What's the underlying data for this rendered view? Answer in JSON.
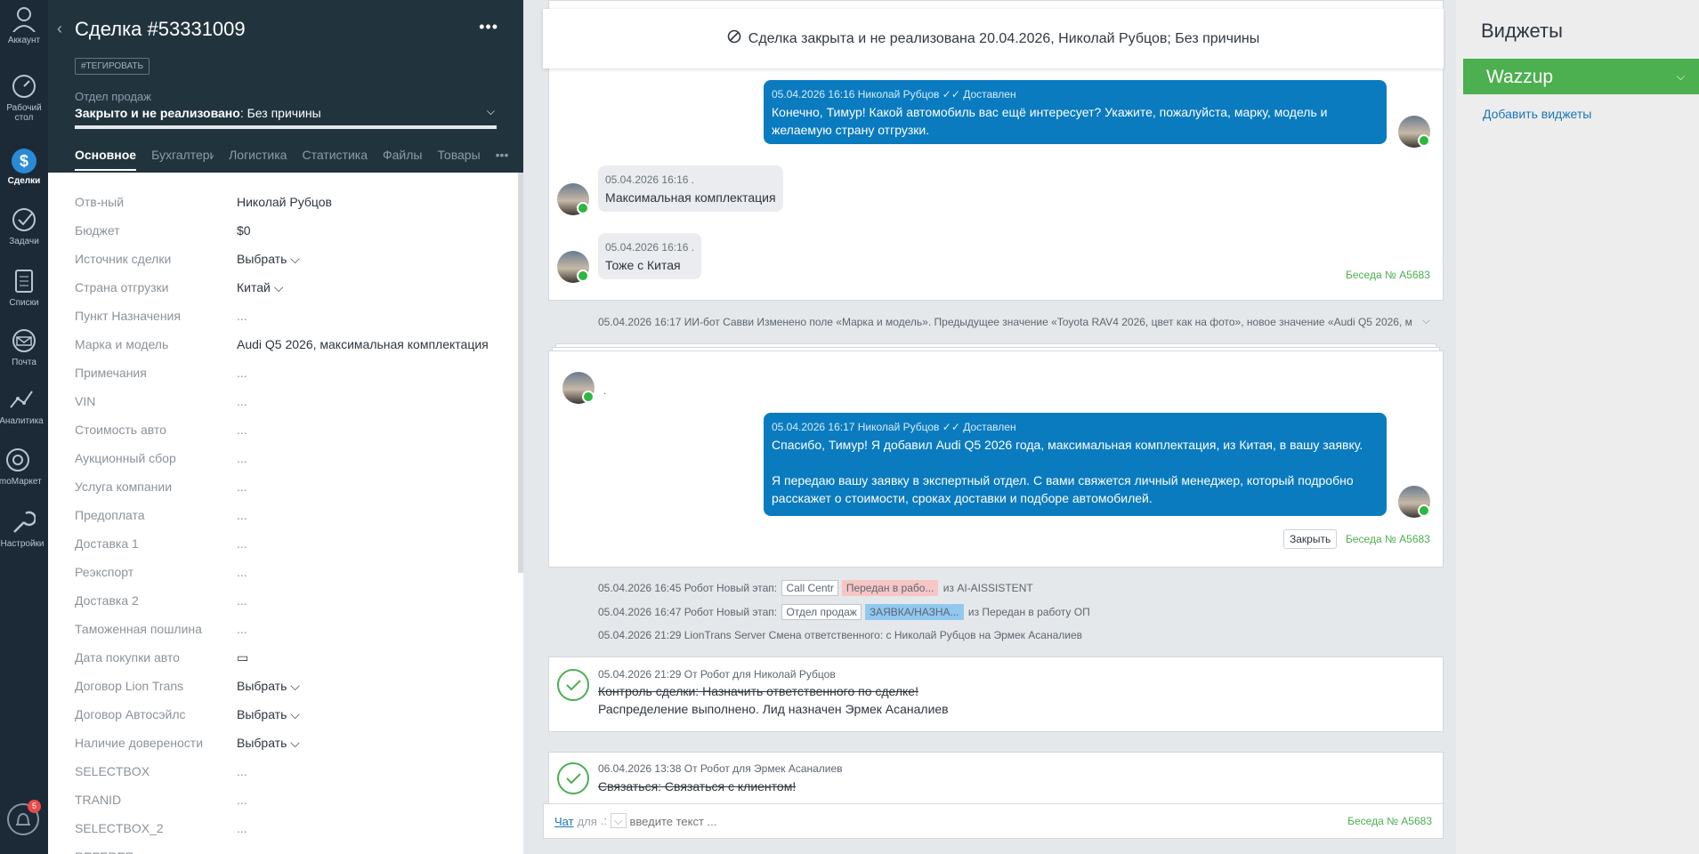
{
  "nav": {
    "items": [
      {
        "label": "Аккаунт"
      },
      {
        "label": "Рабочий стол"
      },
      {
        "label": "Сделки"
      },
      {
        "label": "Задачи"
      },
      {
        "label": "Списки"
      },
      {
        "label": "Почта"
      },
      {
        "label": "Аналитика"
      },
      {
        "label": "amoМаркет"
      },
      {
        "label": "Настройки"
      }
    ],
    "notifications": "5"
  },
  "lead": {
    "title": "Сделка #53331009",
    "tag_button": "#ТЕГИРОВАТЬ",
    "pipeline_label": "Отдел продаж",
    "status_bold": "Закрыто и не реализовано",
    "status_rest": ": Без причины",
    "tabs": [
      "Основное",
      "Бухгалтерия",
      "Логистика",
      "Статистика",
      "Файлы",
      "Товары"
    ]
  },
  "fields": [
    {
      "k": "Отв-ный",
      "v": "Николай Рубцов"
    },
    {
      "k": "Бюджет",
      "v": "$0"
    },
    {
      "k": "Источник сделки",
      "v": "Выбрать ⌵"
    },
    {
      "k": "Страна отгрузки",
      "v": "Китай ⌵"
    },
    {
      "k": "Пункт Назначения",
      "v": "..."
    },
    {
      "k": "Марка и модель",
      "v": "Audi Q5 2026, максимальная комплектация"
    },
    {
      "k": "Примечания",
      "v": "..."
    },
    {
      "k": "VIN",
      "v": "..."
    },
    {
      "k": "Стоимость авто",
      "v": "..."
    },
    {
      "k": "Аукционный сбор",
      "v": "..."
    },
    {
      "k": "Услуга компании",
      "v": "..."
    },
    {
      "k": "Предоплата",
      "v": "..."
    },
    {
      "k": "Доставка 1",
      "v": "..."
    },
    {
      "k": "Реэкспорт",
      "v": "..."
    },
    {
      "k": "Доставка 2",
      "v": "..."
    },
    {
      "k": "Таможенная пошлина",
      "v": "..."
    },
    {
      "k": "Дата покупки авто",
      "v": "▭"
    },
    {
      "k": "Договор Lion Trans",
      "v": "Выбрать ⌵"
    },
    {
      "k": "Договор Автосэйлс",
      "v": "Выбрать ⌵"
    },
    {
      "k": "Наличие доверености",
      "v": "Выбрать ⌵"
    },
    {
      "k": "SELECTBOX",
      "v": "..."
    },
    {
      "k": "TRANID",
      "v": "..."
    },
    {
      "k": "SELECTBOX_2",
      "v": "..."
    },
    {
      "k": "REFERER",
      "v": "..."
    }
  ],
  "feed": {
    "closed_banner": "Сделка закрыта и не реализована 20.04.2026, Николай Рубцов; Без причины",
    "msg1_head": "05.04.2026 16:16 Николай Рубцов ✓✓ Доставлен",
    "msg1_text": "Конечно, Тимур! Какой автомобиль вас ещё интересует? Укажите, пожалуйста, марку, модель и желаемую страну отгрузки.",
    "in1_head": "05.04.2026 16:16 .",
    "in1_text": "Максимальная комплектация",
    "in2_head": "05.04.2026 16:16 .",
    "in2_text": "Тоже с Китая",
    "beseda": "Беседа № A5683",
    "field_change": "05.04.2026 16:17 ИИ-бот Савви Изменено поле «Марка и модель». Предыдущее значение «Toyota RAV4 2026, цвет как на фото», новое значение «Audi Q5 2026, м",
    "dot_name": ".",
    "msg2_head": "05.04.2026 16:17 Николай Рубцов ✓✓ Доставлен",
    "msg2_text1": "Спасибо, Тимур! Я добавил Audi Q5 2026 года, максимальная комплектация, из Китая, в вашу заявку.",
    "msg2_text2": "Я передаю вашу заявку в экспертный отдел. С вами свяжется личный менеджер, который подробно расскажет о стоимости, сроках доставки и подборе автомобилей.",
    "close_btn": "Закрыть",
    "ev1_pre": "05.04.2026 16:45 Робот Новый этап:",
    "ev1_chip1": "Call Centr",
    "ev1_chip2": "Передан в рабо...",
    "ev1_post": "из AI-AISSISTENT",
    "ev2_pre": "05.04.2026 16:47 Робот Новый этап:",
    "ev2_chip1": "Отдел продаж",
    "ev2_chip2": "ЗАЯВКА/НАЗНА...",
    "ev2_post": "из Передан в работу ОП",
    "ev3": "05.04.2026 21:29 LionTrans Server Смена ответственного: с Николай Рубцов на Эрмек Асаналиев",
    "task1_head": "05.04.2026 21:29  От Робот для Николай Рубцов",
    "task1_strike": "Контроль сделки: Назначить ответственного по сделке!",
    "task1_result": "Распределение выполнено. Лид назначен Эрмек Асаналиев",
    "task2_head": "06.04.2026 13:38  От Робот для Эрмек Асаналиев",
    "task2_strike": "Связаться: Связаться с клиентом!",
    "chat_link": "Чат",
    "chat_for": "для",
    "chat_placeholder": "введите текст ..."
  },
  "widgets": {
    "title": "Виджеты",
    "wazzup": "Wazzup",
    "add": "Добавить виджеты"
  },
  "colors": {
    "nav_bg": "#1c2a38",
    "card_head": "#21343e",
    "msg_out": "#0a7bbf",
    "green": "#4caf50"
  }
}
